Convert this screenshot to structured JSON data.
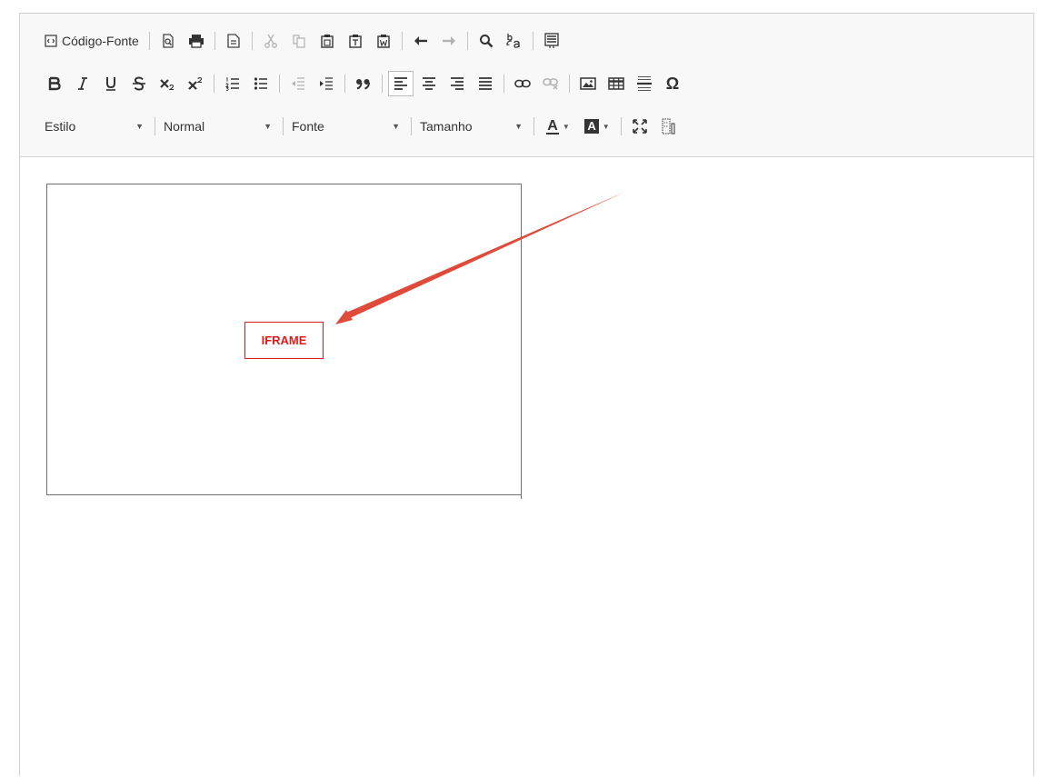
{
  "toolbar": {
    "source_label": "Código-Fonte",
    "style_combo": "Estilo",
    "format_combo": "Normal",
    "font_combo": "Fonte",
    "size_combo": "Tamanho",
    "text_color_letter": "A",
    "bg_color_letter": "A"
  },
  "content": {
    "iframe_placeholder": "IFRAME"
  },
  "colors": {
    "annotation_arrow": "#e04a3a",
    "iframe_label": "#e01b1b"
  }
}
